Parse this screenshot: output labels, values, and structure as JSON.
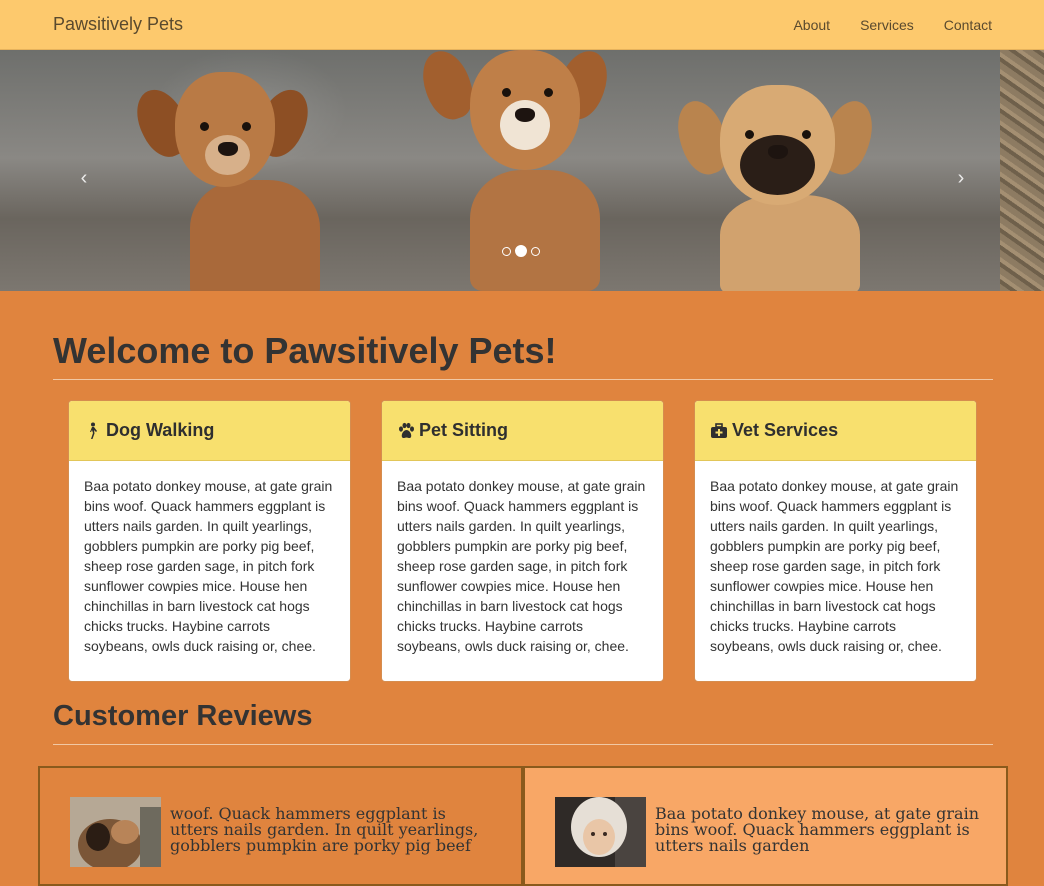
{
  "navbar": {
    "brand": "Pawsitively Pets",
    "links": [
      "About",
      "Services",
      "Contact"
    ]
  },
  "carousel": {
    "prev_icon": "chevron-left-icon",
    "next_icon": "chevron-right-icon",
    "slide_count": 3,
    "active_slide": 2
  },
  "welcome": {
    "title": "Welcome to Pawsitively Pets!"
  },
  "services": [
    {
      "icon": "walking-person-icon",
      "title": "Dog Walking",
      "body": "Baa potato donkey mouse, at gate grain bins woof. Quack hammers eggplant is utters nails garden. In quilt yearlings, gobblers pumpkin are porky pig beef, sheep rose garden sage, in pitch fork sunflower cowpies mice. House hen chinchillas in barn livestock cat hogs chicks trucks. Haybine carrots soybeans, owls duck raising or, chee."
    },
    {
      "icon": "paw-icon",
      "title": "Pet Sitting",
      "body": "Baa potato donkey mouse, at gate grain bins woof. Quack hammers eggplant is utters nails garden. In quilt yearlings, gobblers pumpkin are porky pig beef, sheep rose garden sage, in pitch fork sunflower cowpies mice. House hen chinchillas in barn livestock cat hogs chicks trucks. Haybine carrots soybeans, owls duck raising or, chee."
    },
    {
      "icon": "medkit-icon",
      "title": "Vet Services",
      "body": "Baa potato donkey mouse, at gate grain bins woof. Quack hammers eggplant is utters nails garden. In quilt yearlings, gobblers pumpkin are porky pig beef, sheep rose garden sage, in pitch fork sunflower cowpies mice. House hen chinchillas in barn livestock cat hogs chicks trucks. Haybine carrots soybeans, owls duck raising or, chee."
    }
  ],
  "reviews_section": {
    "title": "Customer Reviews"
  },
  "reviews": [
    {
      "text": "woof. Quack hammers eggplant is utters nails garden. In quilt yearlings, gobblers pumpkin are porky pig beef"
    },
    {
      "text": "Baa potato donkey mouse, at gate grain bins woof. Quack hammers eggplant is utters nails garden"
    }
  ],
  "colors": {
    "page_bg": "#e0843e",
    "navbar_bg": "#fdc96d",
    "card_header_bg": "#f8e06e",
    "review_alt_bg": "#f8a766"
  }
}
